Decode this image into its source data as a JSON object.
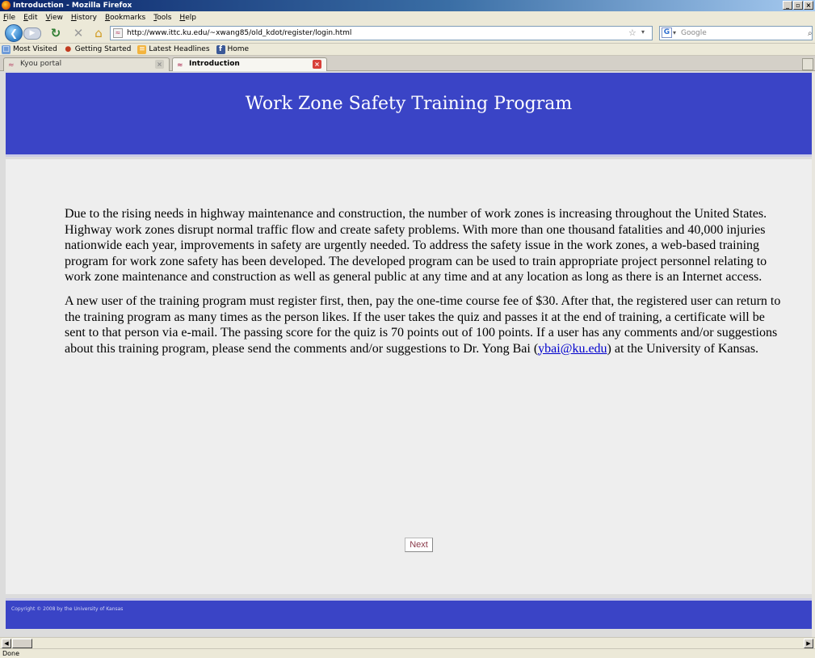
{
  "window": {
    "title": "Introduction - Mozilla Firefox",
    "buttons": [
      "_",
      "▫",
      "×"
    ]
  },
  "menu": [
    "File",
    "Edit",
    "View",
    "History",
    "Bookmarks",
    "Tools",
    "Help"
  ],
  "toolbar": {
    "url": "http://www.ittc.ku.edu/~xwang85/old_kdot/register/login.html",
    "search_placeholder": "Google"
  },
  "bookmarks": [
    "Most Visited",
    "Getting Started",
    "Latest Headlines",
    "Home"
  ],
  "tabs": [
    {
      "label": "Kyou portal",
      "active": false
    },
    {
      "label": "Introduction",
      "active": true
    }
  ],
  "page": {
    "title": "Work Zone Safety Training Program",
    "paragraph1": "Due to the rising needs in highway maintenance and construction, the number of work zones is increasing throughout the United States. Highway work zones disrupt normal traffic flow and create safety problems. With more than one thousand fatalities and 40,000 injuries nationwide each year, improvements in safety are urgently needed. To address the safety issue in the work zones, a web-based training program for work zone safety has been developed. The developed program can be used to train appropriate project personnel relating to work zone maintenance and construction as well as general public at any time and at any location as long as there is an Internet access.",
    "paragraph2_before": "A new user of the training program must register first, then, pay the one-time course fee of $30. After that, the registered user can return to the training program as many times as the person likes. If the user takes the quiz and passes it at the end of training, a certificate will be sent to that person via e-mail. The passing score for the quiz is 70 points out of 100 points. If a user has any comments and/or suggestions about this training program, please send the comments and/or suggestions to Dr. Yong Bai (",
    "email": "ybai@ku.edu",
    "paragraph2_after": ") at the University of Kansas.",
    "next_label": "Next",
    "copyright": "Copyright © 2008 by the University of Kansas"
  },
  "status": "Done",
  "colors": {
    "header_blue": "#3a44c6",
    "link": "#0000cc"
  }
}
